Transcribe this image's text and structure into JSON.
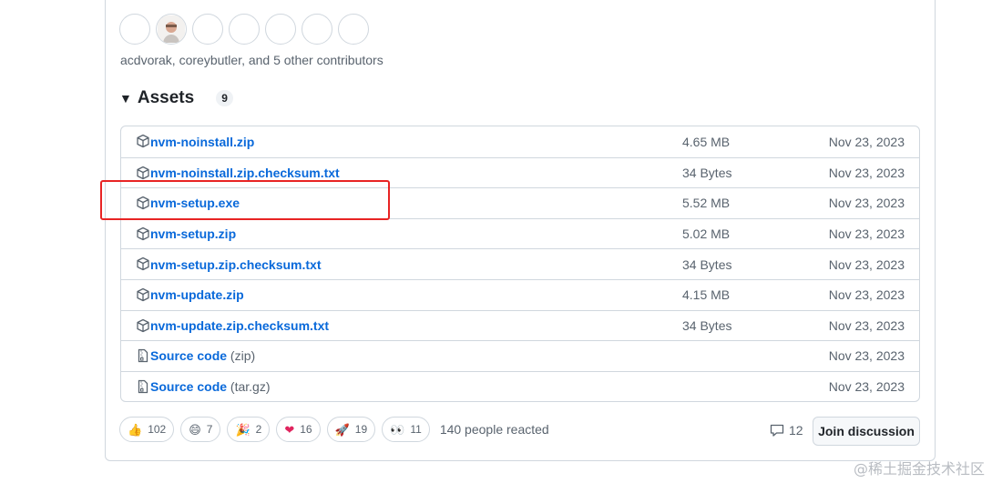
{
  "contributors": {
    "text": "acdvorak, coreybutler, and 5 other contributors",
    "avatar_count": 7
  },
  "assets": {
    "title": "Assets",
    "count": "9",
    "items": [
      {
        "name": "nvm-noinstall.zip",
        "ext": "",
        "size": "4.65 MB",
        "date": "Nov 23, 2023",
        "icon": "package-icon"
      },
      {
        "name": "nvm-noinstall.zip.checksum.txt",
        "ext": "",
        "size": "34 Bytes",
        "date": "Nov 23, 2023",
        "icon": "package-icon"
      },
      {
        "name": "nvm-setup.exe",
        "ext": "",
        "size": "5.52 MB",
        "date": "Nov 23, 2023",
        "icon": "package-icon"
      },
      {
        "name": "nvm-setup.zip",
        "ext": "",
        "size": "5.02 MB",
        "date": "Nov 23, 2023",
        "icon": "package-icon"
      },
      {
        "name": "nvm-setup.zip.checksum.txt",
        "ext": "",
        "size": "34 Bytes",
        "date": "Nov 23, 2023",
        "icon": "package-icon"
      },
      {
        "name": "nvm-update.zip",
        "ext": "",
        "size": "4.15 MB",
        "date": "Nov 23, 2023",
        "icon": "package-icon"
      },
      {
        "name": "nvm-update.zip.checksum.txt",
        "ext": "",
        "size": "34 Bytes",
        "date": "Nov 23, 2023",
        "icon": "package-icon"
      },
      {
        "name": "Source code",
        "ext": "(zip)",
        "size": "",
        "date": "Nov 23, 2023",
        "icon": "file-zip-icon"
      },
      {
        "name": "Source code",
        "ext": "(tar.gz)",
        "size": "",
        "date": "Nov 23, 2023",
        "icon": "file-zip-icon"
      }
    ]
  },
  "reactions": {
    "items": [
      {
        "emoji": "👍",
        "count": "102",
        "icon": "thumbs-up-icon"
      },
      {
        "emoji": "😄",
        "count": "7",
        "icon": "laugh-icon"
      },
      {
        "emoji": "🎉",
        "count": "2",
        "icon": "hooray-icon"
      },
      {
        "emoji": "❤",
        "count": "16",
        "icon": "heart-icon"
      },
      {
        "emoji": "🚀",
        "count": "19",
        "icon": "rocket-icon"
      },
      {
        "emoji": "👀",
        "count": "11",
        "icon": "eyes-icon"
      }
    ],
    "summary": "140 people reacted"
  },
  "discussion": {
    "comment_count": "12",
    "join_label": "Join discussion"
  },
  "watermark": "@稀土掘金技术社区",
  "colors": {
    "link": "#0969da",
    "muted": "#59636e",
    "border": "#d0d7de",
    "highlight": "#e82424"
  }
}
